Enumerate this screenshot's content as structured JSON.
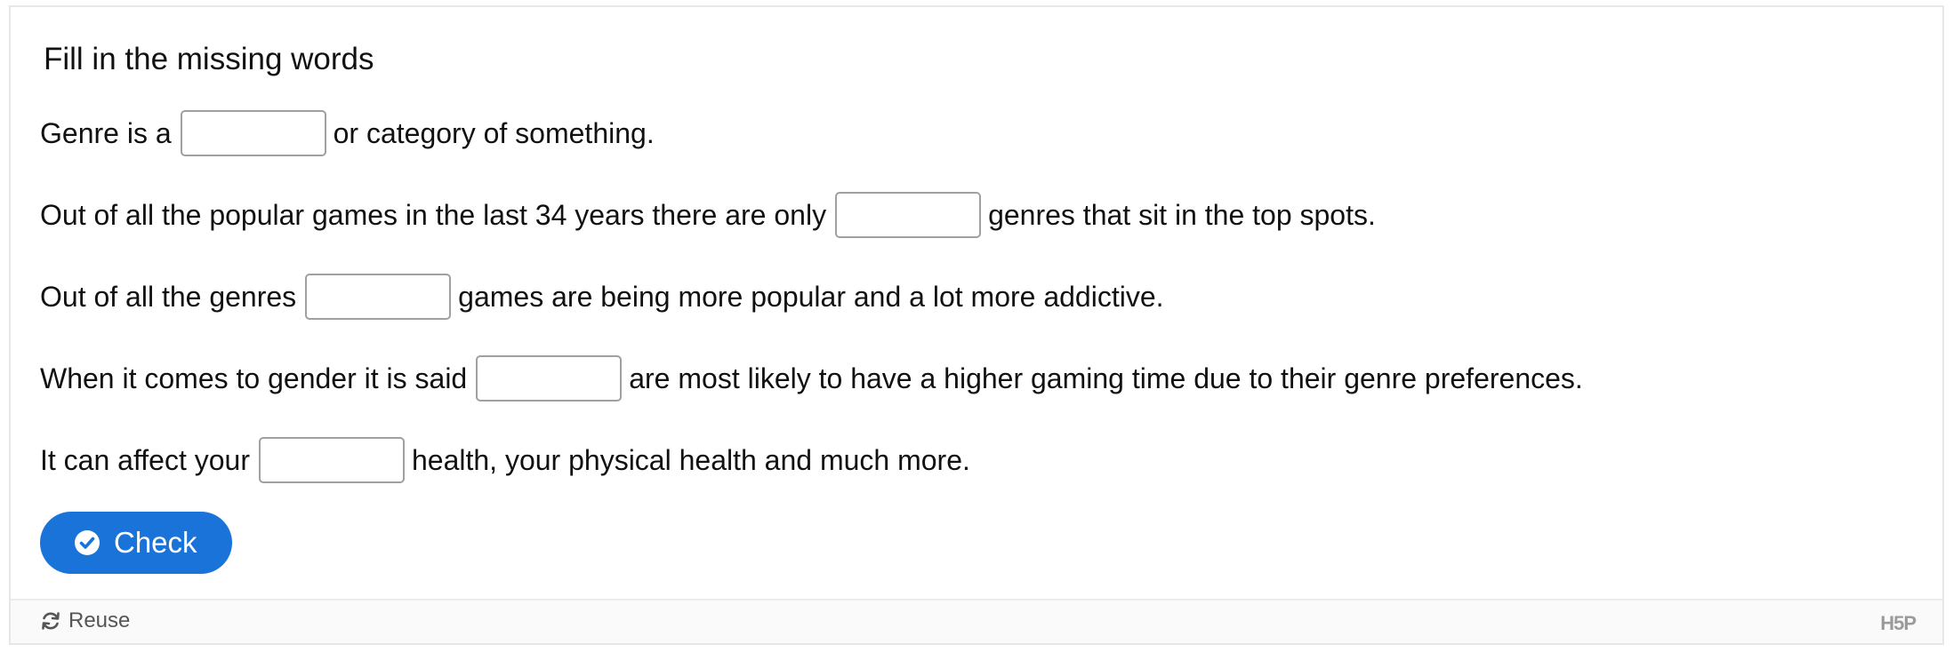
{
  "task": {
    "title": "Fill in the missing words",
    "sentences": [
      {
        "before": "Genre is a",
        "after": "or category of something.",
        "value": ""
      },
      {
        "before": "Out of all the popular games in the last 34 years there are only",
        "after": "genres that sit in the top spots.",
        "value": ""
      },
      {
        "before": "Out of all the genres",
        "after": "games are being more popular and a lot more addictive.",
        "value": ""
      },
      {
        "before": "When it comes to gender it is said",
        "after": "are most likely to have a higher gaming time due to their genre preferences.",
        "value": ""
      },
      {
        "before": "It can affect your",
        "after": "health, your physical health and much more.",
        "value": ""
      }
    ],
    "check_label": "Check",
    "check_icon": "check-circle-icon",
    "accent_color": "#1a73d9"
  },
  "footer": {
    "reuse_label": "Reuse",
    "reuse_icon": "refresh-icon",
    "logo_text": "H5P"
  }
}
